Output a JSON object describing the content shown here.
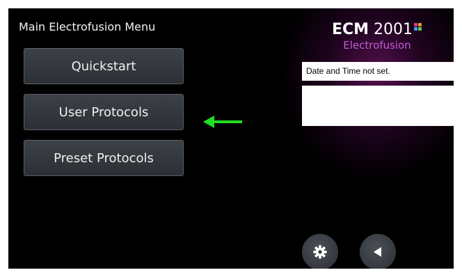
{
  "screen": {
    "title": "Main Electrofusion Menu"
  },
  "menu": {
    "items": [
      {
        "label": "Quickstart"
      },
      {
        "label": "User Protocols"
      },
      {
        "label": "Preset Protocols"
      }
    ]
  },
  "logo": {
    "brand": "ECM",
    "model": "2001",
    "subtitle": "Electrofusion",
    "accent": "#c25bd4"
  },
  "status": {
    "date_time": "Date and Time not set."
  },
  "controls": {
    "settings_icon": "gear-icon",
    "back_icon": "back-arrow-icon"
  },
  "annotation": {
    "arrow_color": "#22dd22",
    "points_to": "User Protocols"
  }
}
